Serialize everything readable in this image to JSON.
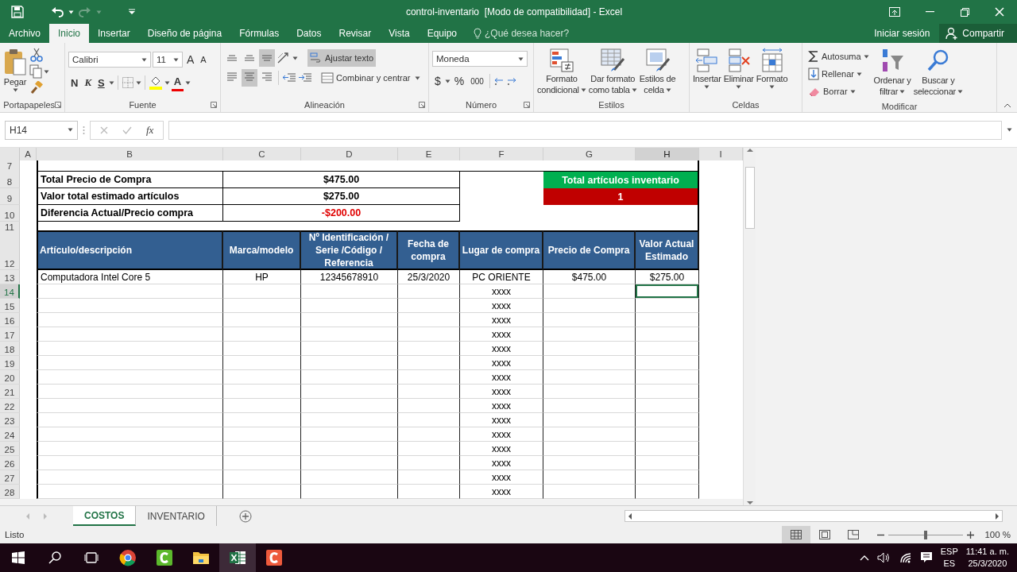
{
  "window": {
    "title": "control-inventario  [Modo de compatibilidad] - Excel"
  },
  "menu_tabs": [
    {
      "label": "Archivo",
      "selected": false
    },
    {
      "label": "Inicio",
      "selected": true
    },
    {
      "label": "Insertar",
      "selected": false
    },
    {
      "label": "Diseño de página",
      "selected": false
    },
    {
      "label": "Fórmulas",
      "selected": false
    },
    {
      "label": "Datos",
      "selected": false
    },
    {
      "label": "Revisar",
      "selected": false
    },
    {
      "label": "Vista",
      "selected": false
    },
    {
      "label": "Equipo",
      "selected": false
    }
  ],
  "tell_me": {
    "placeholder": "¿Qué desea hacer?"
  },
  "account": {
    "sign_in": "Iniciar sesión",
    "share": "Compartir"
  },
  "ribbon": {
    "groups": [
      {
        "kind": "clipboard",
        "label": "Portapapeles",
        "paste": "Pegar"
      },
      {
        "kind": "font",
        "label": "Fuente",
        "font_name": "Calibri",
        "font_size": "11",
        "grow": "A",
        "shrink": "A",
        "bold": "N",
        "italic": "K",
        "underline": "S",
        "font_color": "A"
      },
      {
        "kind": "alignment",
        "label": "Alineación",
        "vertical": [
          {
            "selected": false
          },
          {
            "selected": false
          },
          {
            "selected": true
          }
        ],
        "horizontal": [
          {
            "selected": false
          },
          {
            "selected": true
          },
          {
            "selected": false
          }
        ],
        "wrap_text": {
          "label": "Ajustar texto",
          "on": true
        },
        "merge": "Combinar y centrar"
      },
      {
        "kind": "number",
        "label": "Número",
        "format": "Moneda",
        "currency": "$",
        "percent": "%",
        "thousands": "000"
      },
      {
        "kind": "styles",
        "label": "Estilos",
        "buttons": [
          {
            "kind": "conditional",
            "lines": [
              "Formato",
              "condicional"
            ]
          },
          {
            "kind": "table",
            "lines": [
              "Dar formato",
              "como tabla"
            ]
          },
          {
            "kind": "cell-styles",
            "lines": [
              "Estilos de",
              "celda"
            ]
          }
        ]
      },
      {
        "kind": "cells",
        "label": "Celdas",
        "buttons": [
          {
            "kind": "insert",
            "label": "Insertar"
          },
          {
            "kind": "delete",
            "label": "Eliminar"
          },
          {
            "kind": "format",
            "label": "Formato"
          }
        ]
      },
      {
        "kind": "editing",
        "label": "Modificar",
        "small": [
          {
            "kind": "sum",
            "label": "Autosuma"
          },
          {
            "kind": "fill",
            "label": "Rellenar"
          },
          {
            "kind": "clear",
            "label": "Borrar"
          }
        ],
        "large": [
          {
            "kind": "sort",
            "lines": [
              "Ordenar y",
              "filtrar"
            ]
          },
          {
            "kind": "find",
            "lines": [
              "Buscar y",
              "seleccionar"
            ]
          }
        ]
      }
    ]
  },
  "formula_bar": {
    "name_box": "H14",
    "function_label": "fx"
  },
  "sheet": {
    "columns": [
      {
        "label": "A",
        "selected": false
      },
      {
        "label": "B",
        "selected": false
      },
      {
        "label": "C",
        "selected": false
      },
      {
        "label": "D",
        "selected": false
      },
      {
        "label": "E",
        "selected": false
      },
      {
        "label": "F",
        "selected": false
      },
      {
        "label": "G",
        "selected": false
      },
      {
        "label": "H",
        "selected": true
      },
      {
        "label": "I",
        "selected": false
      }
    ],
    "rows": [
      {
        "number": "7",
        "kind": "blank",
        "selected": false
      },
      {
        "number": "8",
        "kind": "summary",
        "selected": false,
        "label": "Total Precio de Compra",
        "value": "$475.00",
        "negative": false,
        "badge": {
          "kind": "title",
          "text": "Total artículos inventario"
        }
      },
      {
        "number": "9",
        "kind": "summary",
        "selected": false,
        "label": "Valor total estimado artículos",
        "value": "$275.00",
        "negative": false,
        "badge": {
          "kind": "count",
          "text": "1"
        }
      },
      {
        "number": "10",
        "kind": "summary",
        "selected": false,
        "label": "Diferencia  Actual/Precio compra",
        "value": "-$200.00",
        "negative": true
      },
      {
        "number": "11",
        "kind": "gap",
        "selected": false
      },
      {
        "number": "12",
        "kind": "header",
        "selected": false,
        "labels": [
          "Artículo/descripción",
          "Marca/modelo",
          "Nº Identificación / Serie /Código / Referencia",
          "Fecha de compra",
          "Lugar de compra",
          "Precio de Compra",
          "Valor Actual Estimado"
        ]
      },
      {
        "number": "13",
        "kind": "item",
        "selected": false,
        "cells": {
          "description": "Computadora Intel Core 5",
          "brand": "HP",
          "id_number": "12345678910",
          "date": "25/3/2020",
          "place": "PC ORIENTE",
          "price": "$475.00",
          "value": "$275.00"
        }
      },
      {
        "number": "14",
        "kind": "item",
        "selected": true,
        "cells": {
          "place": "xxxx"
        }
      },
      {
        "number": "15",
        "kind": "item",
        "selected": false,
        "cells": {
          "place": "xxxx"
        }
      },
      {
        "number": "16",
        "kind": "item",
        "selected": false,
        "cells": {
          "place": "xxxx"
        }
      },
      {
        "number": "17",
        "kind": "item",
        "selected": false,
        "cells": {
          "place": "xxxx"
        }
      },
      {
        "number": "18",
        "kind": "item",
        "selected": false,
        "cells": {
          "place": "xxxx"
        }
      },
      {
        "number": "19",
        "kind": "item",
        "selected": false,
        "cells": {
          "place": "xxxx"
        }
      },
      {
        "number": "20",
        "kind": "item",
        "selected": false,
        "cells": {
          "place": "xxxx"
        }
      },
      {
        "number": "21",
        "kind": "item",
        "selected": false,
        "cells": {
          "place": "xxxx"
        }
      },
      {
        "number": "22",
        "kind": "item",
        "selected": false,
        "cells": {
          "place": "xxxx"
        }
      },
      {
        "number": "23",
        "kind": "item",
        "selected": false,
        "cells": {
          "place": "xxxx"
        }
      },
      {
        "number": "24",
        "kind": "item",
        "selected": false,
        "cells": {
          "place": "xxxx"
        }
      },
      {
        "number": "25",
        "kind": "item",
        "selected": false,
        "cells": {
          "place": "xxxx"
        }
      },
      {
        "number": "26",
        "kind": "item",
        "selected": false,
        "cells": {
          "place": "xxxx"
        }
      },
      {
        "number": "27",
        "kind": "item",
        "selected": false,
        "cells": {
          "place": "xxxx"
        }
      },
      {
        "number": "28",
        "kind": "item",
        "selected": false,
        "cells": {
          "place": "xxxx"
        }
      }
    ]
  },
  "sheet_tabs": [
    {
      "label": "COSTOS",
      "selected": true
    },
    {
      "label": "INVENTARIO",
      "selected": false
    }
  ],
  "status_bar": {
    "status": "Listo",
    "views": [
      {
        "kind": "normal",
        "selected": true
      },
      {
        "kind": "page-layout",
        "selected": false
      },
      {
        "kind": "page-break",
        "selected": false
      }
    ],
    "zoom": {
      "level": 0.5,
      "reading": "100 %"
    }
  },
  "taskbar": {
    "apps": [
      {
        "kind": "browser",
        "active": false
      },
      {
        "kind": "green-app",
        "active": false
      },
      {
        "kind": "folder",
        "active": false
      },
      {
        "kind": "spreadsheet",
        "active": true
      },
      {
        "kind": "red-app",
        "active": false
      }
    ],
    "language": "ESP",
    "layout": "ES",
    "time": "11:41 a. m.",
    "date": "25/3/2020"
  }
}
